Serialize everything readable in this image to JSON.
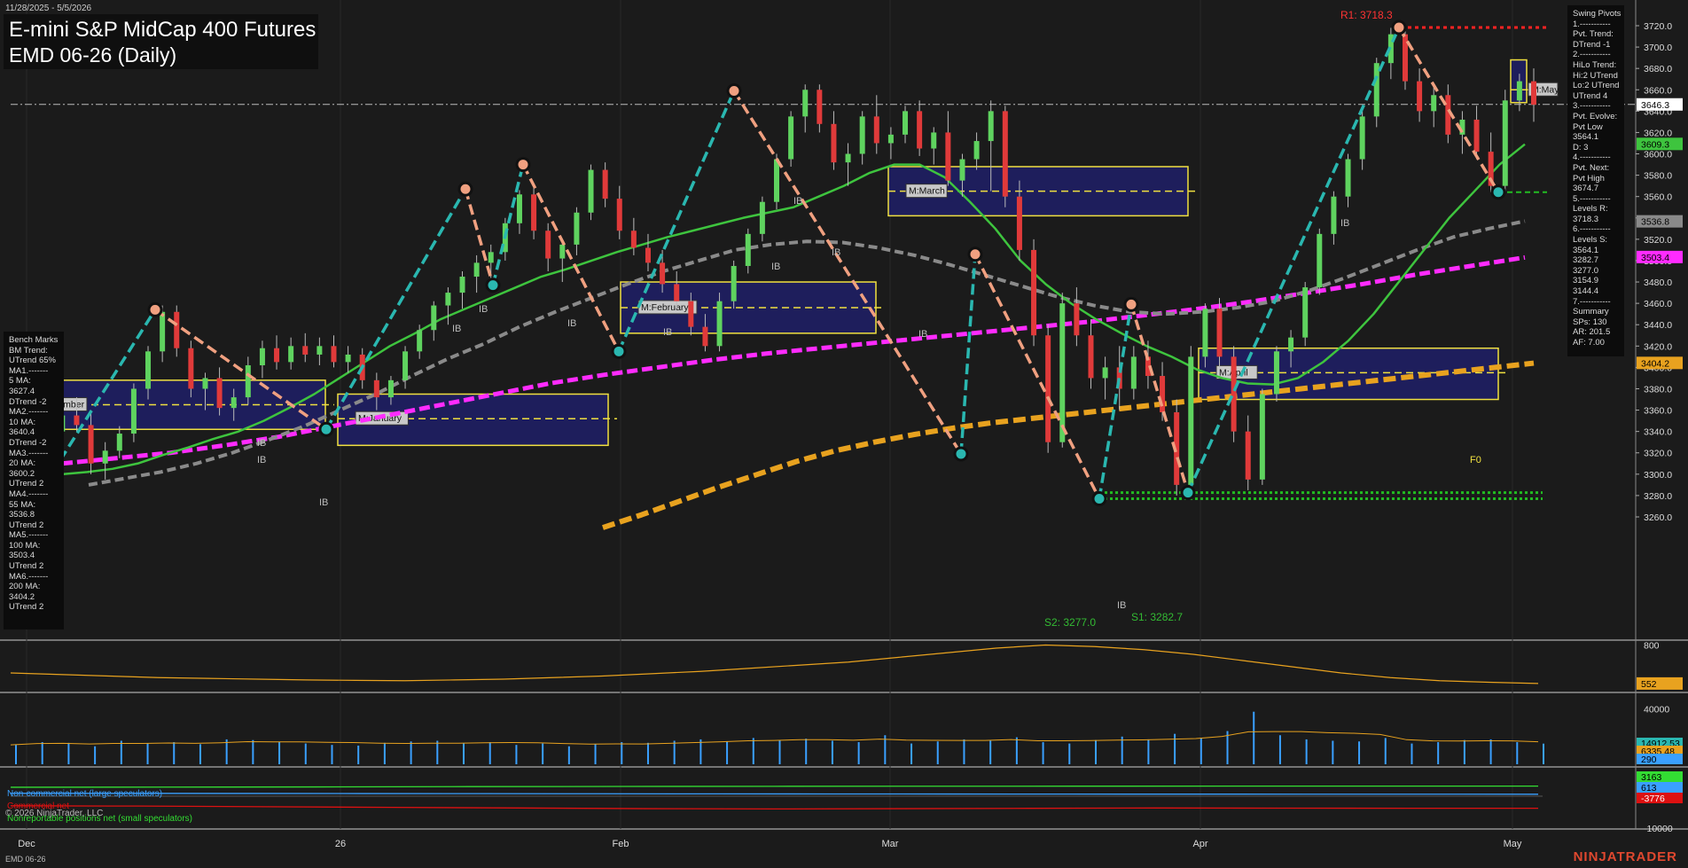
{
  "header": {
    "date_range": "11/28/2025 - 5/5/2026",
    "title_line1": "E-mini S&P MidCap 400 Futures",
    "title_line2": "EMD 06-26 (Daily)",
    "footer_symbol": "EMD 06-26",
    "brand": "NINJATRADER",
    "copyright": "© 2026 NinjaTrader, LLC"
  },
  "colors": {
    "background": "#1b1b1b",
    "bull_candle": "#5fd35f",
    "bear_candle": "#e03a3a",
    "swing_up": "#2ab7b0",
    "swing_down": "#f0a080",
    "ma20": "#3ec43e",
    "ma55": "#8a8a8a",
    "ma100": "#ff2bff",
    "ma200": "#e8a21f",
    "vpoc_box": "#1e1e5c",
    "vpoc_border": "#f0e040",
    "resistance": "#ff2222",
    "support": "#22bb22",
    "volume": "#3aa0ff",
    "oi": "#e8a21f",
    "cot_large": "#3aa0ff",
    "cot_commercial": "#dd1111",
    "cot_small": "#33dd33"
  },
  "benchmarks_panel": {
    "title": "Bench Marks",
    "lines": [
      "BM Trend:",
      "UTrend 65%",
      "MA1.-------",
      "5 MA:",
      "3627.4",
      "DTrend -2",
      "MA2.-------",
      "10 MA:",
      "3640.4",
      "DTrend -2",
      "MA3.-------",
      "20 MA:",
      "3600.2",
      "UTrend 2",
      "MA4.-------",
      "55 MA:",
      "3536.8",
      "UTrend 2",
      "MA5.-------",
      "100 MA:",
      "3503.4",
      "UTrend 2",
      "MA6.-------",
      "200 MA:",
      "3404.2",
      "UTrend 2"
    ]
  },
  "swing_panel": {
    "lines": [
      "Swing Pivots",
      "1.-----------",
      "Pvt. Trend:",
      "DTrend -1",
      "2.-----------",
      "HiLo Trend:",
      "Hi:2 UTrend",
      "Lo:2 UTrend",
      "UTrend 4",
      "3.-----------",
      "Pvt. Evolve:",
      "Pvt Low",
      "3564.1",
      "D: 3",
      "4.-----------",
      "Pvt. Next:",
      "Pvt High",
      "3674.7",
      "5.-----------",
      "Levels R:",
      "3718.3",
      "6.-----------",
      "Levels S:",
      "3564.1",
      "3282.7",
      "3277.0",
      "3154.9",
      "3144.4",
      "7.-----------",
      "Summary",
      "SPs: 130",
      "AR: 201.5",
      "AF: 7.00"
    ]
  },
  "price_axis": {
    "ticks": [
      "3720.0",
      "3700.0",
      "3680.0",
      "3660.0",
      "3640.0",
      "3620.0",
      "3600.0",
      "3580.0",
      "3560.0",
      "3540.0",
      "3520.0",
      "3500.0",
      "3480.0",
      "3460.0",
      "3440.0",
      "3420.0",
      "3400.0",
      "3380.0",
      "3360.0",
      "3340.0",
      "3320.0",
      "3300.0",
      "3280.0",
      "3260.0"
    ],
    "badges": [
      {
        "label": "3646.3",
        "value": 3646.3,
        "bg": "#ffffff",
        "fg": "#000000"
      },
      {
        "label": "3609.3",
        "value": 3609.3,
        "bg": "#3ec43e",
        "fg": "#000000"
      },
      {
        "label": "3536.8",
        "value": 3536.8,
        "bg": "#8a8a8a",
        "fg": "#000000"
      },
      {
        "label": "3503.4",
        "value": 3503.4,
        "bg": "#ff2bff",
        "fg": "#000000"
      },
      {
        "label": "3404.2",
        "value": 3404.2,
        "bg": "#e8a21f",
        "fg": "#000000"
      }
    ]
  },
  "oi_axis": {
    "ticks": [
      "800"
    ],
    "badge": {
      "label": "552",
      "bg": "#e8a21f",
      "fg": "#000000"
    }
  },
  "volume_axis": {
    "ticks": [
      "40000"
    ],
    "badges": [
      {
        "label": "14912.53",
        "bg": "#2ab7b0",
        "fg": "#000000"
      },
      {
        "label": "6335.48",
        "bg": "#e8a21f",
        "fg": "#000000"
      },
      {
        "label": "290",
        "bg": "#3aa0ff",
        "fg": "#000000"
      }
    ]
  },
  "cot_axis": {
    "ticks": [
      "-10000"
    ],
    "badges": [
      {
        "label": "3163",
        "bg": "#33dd33",
        "fg": "#000000"
      },
      {
        "label": "613",
        "bg": "#3aa0ff",
        "fg": "#000000"
      },
      {
        "label": "-3776",
        "bg": "#dd1111",
        "fg": "#ffffff"
      }
    ]
  },
  "cot_legend": [
    {
      "label": "Non-commercial net (large speculators)",
      "color": "#3aa0ff"
    },
    {
      "label": "Commercial net",
      "color": "#dd1111"
    },
    {
      "label": "Nonreportable positions net (small speculators)",
      "color": "#33dd33"
    }
  ],
  "time_axis": {
    "labels": [
      "Dec",
      "26",
      "Feb",
      "Mar",
      "Apr",
      "May"
    ]
  },
  "levels": {
    "r1": "R1: 3718.3",
    "s1": "S1: 3282.7",
    "s2": "S2: 3277.0"
  },
  "month_boxes": [
    "M:December",
    "M:January",
    "M:February",
    "M:March",
    "M:April",
    "M:May"
  ],
  "annotations": {
    "ib": "IB",
    "fo": "F0"
  },
  "chart_data": {
    "type": "candlestick",
    "title": "E-mini S&P MidCap 400 Futures EMD 06-26 (Daily)",
    "ylim": [
      3250,
      3735
    ],
    "x_start": "2025-11-28",
    "x_end": "2026-05-05",
    "candles": [
      [
        3290,
        3340,
        3275,
        3328
      ],
      [
        3328,
        3345,
        3310,
        3318
      ],
      [
        3318,
        3350,
        3300,
        3340
      ],
      [
        3340,
        3362,
        3325,
        3355
      ],
      [
        3355,
        3372,
        3340,
        3346
      ],
      [
        3346,
        3360,
        3300,
        3310
      ],
      [
        3310,
        3330,
        3295,
        3322
      ],
      [
        3322,
        3345,
        3315,
        3338
      ],
      [
        3338,
        3385,
        3330,
        3380
      ],
      [
        3380,
        3420,
        3370,
        3415
      ],
      [
        3415,
        3458,
        3405,
        3452
      ],
      [
        3452,
        3458,
        3410,
        3418
      ],
      [
        3418,
        3425,
        3372,
        3380
      ],
      [
        3380,
        3395,
        3360,
        3390
      ],
      [
        3390,
        3400,
        3355,
        3362
      ],
      [
        3362,
        3380,
        3350,
        3372
      ],
      [
        3372,
        3410,
        3365,
        3402
      ],
      [
        3402,
        3425,
        3390,
        3418
      ],
      [
        3418,
        3430,
        3398,
        3405
      ],
      [
        3405,
        3428,
        3398,
        3420
      ],
      [
        3420,
        3432,
        3405,
        3412
      ],
      [
        3412,
        3428,
        3402,
        3420
      ],
      [
        3420,
        3430,
        3400,
        3405
      ],
      [
        3405,
        3420,
        3395,
        3412
      ],
      [
        3412,
        3418,
        3380,
        3388
      ],
      [
        3388,
        3395,
        3360,
        3372
      ],
      [
        3372,
        3392,
        3365,
        3388
      ],
      [
        3388,
        3420,
        3380,
        3415
      ],
      [
        3415,
        3440,
        3408,
        3435
      ],
      [
        3435,
        3462,
        3425,
        3458
      ],
      [
        3458,
        3475,
        3440,
        3470
      ],
      [
        3470,
        3490,
        3455,
        3485
      ],
      [
        3485,
        3505,
        3470,
        3498
      ],
      [
        3498,
        3515,
        3482,
        3508
      ],
      [
        3508,
        3540,
        3500,
        3535
      ],
      [
        3535,
        3566,
        3525,
        3562
      ],
      [
        3562,
        3568,
        3520,
        3528
      ],
      [
        3528,
        3535,
        3490,
        3502
      ],
      [
        3502,
        3520,
        3480,
        3515
      ],
      [
        3515,
        3550,
        3505,
        3545
      ],
      [
        3545,
        3590,
        3538,
        3585
      ],
      [
        3585,
        3592,
        3550,
        3558
      ],
      [
        3558,
        3570,
        3520,
        3528
      ],
      [
        3528,
        3540,
        3505,
        3512
      ],
      [
        3512,
        3525,
        3490,
        3498
      ],
      [
        3498,
        3510,
        3470,
        3478
      ],
      [
        3478,
        3490,
        3455,
        3462
      ],
      [
        3462,
        3470,
        3430,
        3438
      ],
      [
        3438,
        3450,
        3415,
        3420
      ],
      [
        3420,
        3470,
        3415,
        3462
      ],
      [
        3462,
        3500,
        3455,
        3495
      ],
      [
        3495,
        3530,
        3488,
        3525
      ],
      [
        3525,
        3560,
        3518,
        3555
      ],
      [
        3555,
        3600,
        3548,
        3595
      ],
      [
        3595,
        3640,
        3588,
        3635
      ],
      [
        3635,
        3665,
        3620,
        3660
      ],
      [
        3660,
        3665,
        3620,
        3628
      ],
      [
        3628,
        3640,
        3585,
        3592
      ],
      [
        3592,
        3610,
        3570,
        3600
      ],
      [
        3600,
        3640,
        3590,
        3635
      ],
      [
        3635,
        3655,
        3600,
        3610
      ],
      [
        3610,
        3625,
        3595,
        3618
      ],
      [
        3618,
        3645,
        3610,
        3640
      ],
      [
        3640,
        3650,
        3598,
        3605
      ],
      [
        3605,
        3625,
        3590,
        3620
      ],
      [
        3620,
        3640,
        3570,
        3575
      ],
      [
        3575,
        3600,
        3560,
        3595
      ],
      [
        3595,
        3620,
        3585,
        3612
      ],
      [
        3612,
        3650,
        3565,
        3640
      ],
      [
        3640,
        3645,
        3550,
        3560
      ],
      [
        3560,
        3575,
        3500,
        3510
      ],
      [
        3510,
        3520,
        3420,
        3430
      ],
      [
        3430,
        3440,
        3320,
        3330
      ],
      [
        3330,
        3470,
        3325,
        3460
      ],
      [
        3460,
        3475,
        3420,
        3430
      ],
      [
        3430,
        3445,
        3380,
        3390
      ],
      [
        3390,
        3410,
        3370,
        3400
      ],
      [
        3400,
        3420,
        3360,
        3380
      ],
      [
        3380,
        3420,
        3370,
        3410
      ],
      [
        3410,
        3425,
        3380,
        3392
      ],
      [
        3392,
        3405,
        3350,
        3358
      ],
      [
        3358,
        3370,
        3280,
        3290
      ],
      [
        3290,
        3420,
        3282,
        3410
      ],
      [
        3410,
        3460,
        3400,
        3455
      ],
      [
        3455,
        3465,
        3400,
        3410
      ],
      [
        3410,
        3420,
        3330,
        3340
      ],
      [
        3340,
        3355,
        3285,
        3295
      ],
      [
        3295,
        3380,
        3290,
        3375
      ],
      [
        3375,
        3420,
        3368,
        3415
      ],
      [
        3415,
        3435,
        3400,
        3428
      ],
      [
        3428,
        3480,
        3420,
        3475
      ],
      [
        3475,
        3530,
        3468,
        3525
      ],
      [
        3525,
        3565,
        3515,
        3560
      ],
      [
        3560,
        3600,
        3550,
        3595
      ],
      [
        3595,
        3640,
        3585,
        3635
      ],
      [
        3635,
        3690,
        3625,
        3685
      ],
      [
        3685,
        3718,
        3670,
        3712
      ],
      [
        3712,
        3715,
        3660,
        3668
      ],
      [
        3668,
        3680,
        3630,
        3640
      ],
      [
        3640,
        3665,
        3625,
        3655
      ],
      [
        3655,
        3665,
        3610,
        3618
      ],
      [
        3618,
        3640,
        3600,
        3632
      ],
      [
        3632,
        3645,
        3595,
        3602
      ],
      [
        3602,
        3620,
        3564,
        3570
      ],
      [
        3570,
        3660,
        3564,
        3650
      ],
      [
        3650,
        3675,
        3640,
        3668
      ],
      [
        3668,
        3680,
        3630,
        3646
      ]
    ],
    "ma20": [
      3300,
      3302,
      3305,
      3310,
      3318,
      3325,
      3333,
      3340,
      3350,
      3362,
      3375,
      3390,
      3405,
      3420,
      3432,
      3445,
      3455,
      3465,
      3475,
      3485,
      3492,
      3500,
      3508,
      3515,
      3522,
      3528,
      3534,
      3540,
      3545,
      3550,
      3560,
      3570,
      3582,
      3590,
      3590,
      3578,
      3555,
      3530,
      3500,
      3478,
      3460,
      3445,
      3432,
      3420,
      3410,
      3398,
      3390,
      3385,
      3384,
      3390,
      3405,
      3425,
      3450,
      3480,
      3510,
      3540,
      3565,
      3590,
      3609
    ],
    "ma55": [
      3290,
      3296,
      3302,
      3310,
      3320,
      3332,
      3345,
      3360,
      3375,
      3392,
      3408,
      3422,
      3438,
      3452,
      3465,
      3478,
      3490,
      3500,
      3510,
      3515,
      3518,
      3517,
      3512,
      3505,
      3496,
      3486,
      3476,
      3466,
      3458,
      3452,
      3450,
      3452,
      3456,
      3462,
      3472,
      3484,
      3497,
      3510,
      3522,
      3530,
      3537
    ],
    "ma100": [
      3310,
      3315,
      3320,
      3327,
      3335,
      3345,
      3355,
      3365,
      3375,
      3385,
      3393,
      3400,
      3407,
      3413,
      3418,
      3423,
      3428,
      3433,
      3438,
      3443,
      3449,
      3455,
      3462,
      3470,
      3478,
      3487,
      3495,
      3503
    ],
    "ma200": [
      3250,
      3262,
      3275,
      3288,
      3300,
      3312,
      3322,
      3330,
      3337,
      3343,
      3348,
      3352,
      3356,
      3360,
      3364,
      3368,
      3372,
      3376,
      3380,
      3384,
      3388,
      3392,
      3396,
      3400,
      3404
    ],
    "swing_pivots": [
      {
        "type": "low",
        "value": 3250
      },
      {
        "type": "high",
        "value": 3454
      },
      {
        "type": "low",
        "value": 3342
      },
      {
        "type": "high",
        "value": 3412
      },
      {
        "type": "low",
        "value": 3372
      },
      {
        "type": "high",
        "value": 3567
      },
      {
        "type": "low",
        "value": 3477
      },
      {
        "type": "high",
        "value": 3590
      },
      {
        "type": "low",
        "value": 3415
      },
      {
        "type": "high",
        "value": 3659
      },
      {
        "type": "low",
        "value": 3319
      },
      {
        "type": "high",
        "value": 3506
      },
      {
        "type": "low",
        "value": 3277
      },
      {
        "type": "high",
        "value": 3459
      },
      {
        "type": "low",
        "value": 3282.7
      },
      {
        "type": "high",
        "value": 3718.3
      },
      {
        "type": "low",
        "value": 3564.1
      }
    ],
    "monthly_value_areas": [
      {
        "name": "M:December",
        "high": 3388,
        "low": 3342,
        "poc": 3365
      },
      {
        "name": "M:January",
        "high": 3375,
        "low": 3327,
        "poc": 3352
      },
      {
        "name": "M:February",
        "high": 3480,
        "low": 3432,
        "poc": 3456
      },
      {
        "name": "M:March",
        "high": 3588,
        "low": 3542,
        "poc": 3565
      },
      {
        "name": "M:April",
        "high": 3418,
        "low": 3370,
        "poc": 3395
      },
      {
        "name": "M:May",
        "high": 3688,
        "low": 3648,
        "poc": 3660
      }
    ],
    "levels": {
      "R1": 3718.3,
      "S1": 3282.7,
      "S2": 3277.0,
      "last": 3646.3
    },
    "volume": [
      14000,
      16000,
      15500,
      13000,
      17000,
      15000,
      16000,
      14500,
      18000,
      17500,
      16000,
      15000,
      14000,
      13500,
      15500,
      16500,
      17000,
      15000,
      16000,
      14000,
      15000,
      13000,
      14500,
      16000,
      15500,
      17000,
      18000,
      16500,
      19000,
      17500,
      18500,
      17000,
      16000,
      21000,
      15000,
      16500,
      18000,
      17000,
      19500,
      16000,
      15000,
      17500,
      20000,
      18000,
      22000,
      19000,
      24000,
      38000,
      21000,
      18000,
      17000,
      16500,
      19000,
      15000,
      16000,
      17500,
      18000,
      16000,
      14912.53
    ],
    "open_interest": [
      620,
      610,
      600,
      590,
      585,
      580,
      575,
      572,
      570,
      575,
      580,
      590,
      600,
      615,
      630,
      650,
      670,
      690,
      720,
      750,
      780,
      800,
      790,
      770,
      740,
      700,
      660,
      620,
      590,
      570,
      560,
      552
    ],
    "cot": {
      "noncommercial": [
        900,
        880,
        850,
        820,
        800,
        760,
        720,
        700,
        680,
        650,
        640,
        630,
        620,
        613
      ],
      "commercial": [
        -3000,
        -3100,
        -3300,
        -3500,
        -3700,
        -3900,
        -4000,
        -3900,
        -3800,
        -3700,
        -3750,
        -3780,
        -3776
      ],
      "nonreportable": [
        2800,
        2850,
        2900,
        3000,
        3050,
        3100,
        3120,
        3140,
        3150,
        3160,
        3163
      ]
    }
  }
}
